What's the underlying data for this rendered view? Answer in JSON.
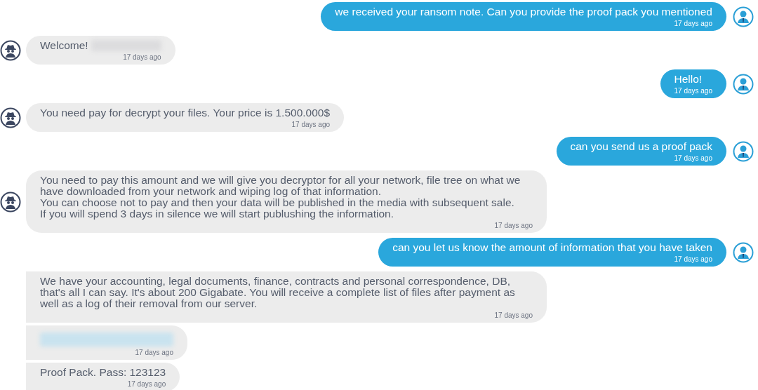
{
  "messages": [
    {
      "kind": "sent",
      "avatar": true,
      "paragraphs": [
        "we received your ransom note.  Can you provide the proof pack you mentioned"
      ],
      "time": "17 days ago"
    },
    {
      "kind": "received",
      "avatar": true,
      "paragraphs": [
        "Welcome!"
      ],
      "redacted": true,
      "time": "17 days ago"
    },
    {
      "kind": "sent",
      "avatar": true,
      "paragraphs": [
        "Hello!"
      ],
      "time": "17 days ago"
    },
    {
      "kind": "received",
      "avatar": true,
      "paragraphs": [
        "You need pay for decrypt your files. Your price is 1.500.000$"
      ],
      "time": "17 days ago"
    },
    {
      "kind": "sent",
      "avatar": true,
      "paragraphs": [
        "can you send us a proof pack"
      ],
      "time": "17 days ago"
    },
    {
      "kind": "received",
      "avatar": true,
      "paragraphs": [
        "You need to pay this amount and we will give you decryptor for all your network, file tree on what we have downloaded from your network and wiping log of that information.",
        "You can choose not to pay and then your data will be published in the media with subsequent sale.",
        "If you will spend 3 days in silence we will start publushing the information."
      ],
      "time": "17 days ago"
    },
    {
      "kind": "sent",
      "avatar": true,
      "paragraphs": [
        "can you let us know the amount of information that you have taken"
      ],
      "time": "17 days ago"
    },
    {
      "kind": "received",
      "avatar": false,
      "paragraphs": [
        "We have your accounting, legal documents, finance,  contracts and personal correspondence, DB, that's all I can say. It's about 200 Gigabate. You will receive a complete list of files after payment as well as a log of their removal from our server."
      ],
      "time": "17 days ago"
    },
    {
      "kind": "received",
      "avatar": false,
      "redacted": true,
      "time": "17 days ago"
    },
    {
      "kind": "received",
      "avatar": false,
      "paragraphs": [
        "Proof Pack. Pass: 123123"
      ],
      "time": "17 days ago"
    }
  ]
}
